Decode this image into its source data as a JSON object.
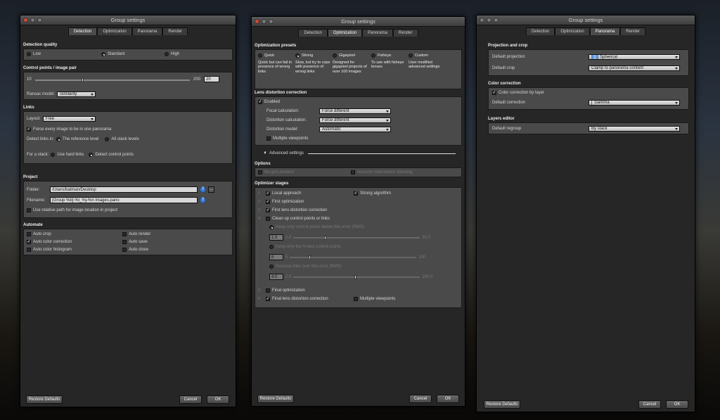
{
  "windows": {
    "detection": {
      "title": "Group settings",
      "tabs": [
        "Detection",
        "Optimization",
        "Panorama",
        "Render"
      ],
      "detection_quality": {
        "title": "Detection quality",
        "options": [
          "Low",
          "Standard",
          "High"
        ],
        "selected": "Standard"
      },
      "control_points": {
        "title": "Control points / image pair",
        "min": "10",
        "max": "200",
        "value": "20",
        "slider_fraction": 0.3,
        "ransac_label": "Ransac model:",
        "ransac_value": "Similarity"
      },
      "links": {
        "title": "Links",
        "layout_label": "Layout:",
        "layout_value": "Free",
        "force_label": "Force every image to be in one panorama",
        "force_checked": true,
        "detect_in_label": "Detect links in:",
        "detect_in_options": [
          "The reference level",
          "All stack levels"
        ],
        "detect_in_selected": "The reference level",
        "stack_label": "For a stack:",
        "stack_options": [
          "Use hard links",
          "Detect control points"
        ],
        "stack_selected": "Detect control points"
      },
      "project": {
        "title": "Project",
        "folder_label": "Folder:",
        "folder_value": "/Users/batman/Desktop",
        "filename_label": "Filename:",
        "filename_value": "[Group %b]-%i_%j-%n images.pano",
        "relative_label": "Use relative path for image location in project",
        "relative_checked": false
      },
      "automate": {
        "title": "Automate",
        "items": [
          {
            "label": "Auto crop",
            "checked": false
          },
          {
            "label": "Auto render",
            "checked": false
          },
          {
            "label": "Auto color correction",
            "checked": true
          },
          {
            "label": "Auto save",
            "checked": false
          },
          {
            "label": "Auto color histogram",
            "checked": false
          },
          {
            "label": "Auto close",
            "checked": false
          }
        ]
      },
      "buttons": {
        "restore": "Restore Defaults",
        "cancel": "Cancel",
        "ok": "OK"
      }
    },
    "optimization": {
      "title": "Group settings",
      "tabs": [
        "Detection",
        "Optimization",
        "Panorama",
        "Render"
      ],
      "presets": {
        "title": "Optimization presets",
        "selected": "Strong",
        "items": [
          {
            "label": "Quick",
            "desc": "Quick but can fail in presence of wrong links"
          },
          {
            "label": "Strong",
            "desc": "Slow, but try to cope with presence of wrong links"
          },
          {
            "label": "Gigapixel",
            "desc": "Designed for gigapixel projects of over 100 images"
          },
          {
            "label": "Fisheye",
            "desc": "To use with fisheye lenses"
          },
          {
            "label": "Custom",
            "desc": "User modified advanced settings"
          }
        ]
      },
      "lens": {
        "title": "Lens distortion correction",
        "enabled_label": "Enabled",
        "enabled_checked": true,
        "focal_label": "Focal calculation:",
        "focal_value": "Force different",
        "distortion_label": "Distortion calculation:",
        "distortion_value": "Force different",
        "model_label": "Distortion model:",
        "model_value": "Automatic",
        "multi_label": "Multiple viewpoints",
        "multi_checked": false
      },
      "advanced_label": "Advanced settings",
      "options": {
        "title": "Options",
        "grid_label": "Re-grid position",
        "rows_label": "Assume row/column shooting"
      },
      "stages": {
        "title": "Optimizer stages",
        "local_label": "Local approach",
        "strong_label": "Strong algorithm",
        "first_opt_label": "First optimization",
        "first_lens_label": "First lens distortion correction",
        "cleanup_label": "Clean up control points or links",
        "keep_error_label": "Keep only control points below this error (RMS)",
        "keep_error_value": "1.0",
        "keep_error_min": "2.0",
        "keep_error_max": "20.0",
        "keep_n_label": "Keep only the N best control points",
        "keep_n_value": "8",
        "keep_n_min": "5",
        "keep_n_max": "100",
        "remove_label": "Remove links over this error (RMS)",
        "remove_value": "4.0",
        "remove_min": "2.0",
        "remove_max": "100.0",
        "final_opt_label": "Final optimization",
        "final_lens_label": "Final lens distortion correction",
        "multi_label": "Multiple viewpoints",
        "numbers": [
          "1",
          "2",
          "3",
          "4",
          "5",
          "6"
        ]
      },
      "buttons": {
        "restore": "Restore Defaults",
        "cancel": "Cancel",
        "ok": "OK"
      }
    },
    "panorama": {
      "title": "Group settings",
      "tabs": [
        "Detection",
        "Optimization",
        "Panorama",
        "Render"
      ],
      "projection": {
        "title": "Projection and crop",
        "projection_label": "Default projection",
        "projection_value": "Spherical",
        "crop_label": "Default crop",
        "crop_value": "Clamp to panorama content"
      },
      "color": {
        "title": "Color correction",
        "by_layer_label": "Color correction by layer",
        "by_layer_checked": true,
        "default_label": "Default correction",
        "default_value": "Gamma"
      },
      "layers": {
        "title": "Layers editor",
        "regroup_label": "Default regroup",
        "regroup_value": "By stack"
      },
      "buttons": {
        "restore": "Restore Defaults",
        "cancel": "Cancel",
        "ok": "OK"
      }
    }
  },
  "colors": {
    "panel": "#4a4a4a",
    "window": "#262626",
    "accent": "#3b7bd1",
    "close": "#d9483b"
  }
}
